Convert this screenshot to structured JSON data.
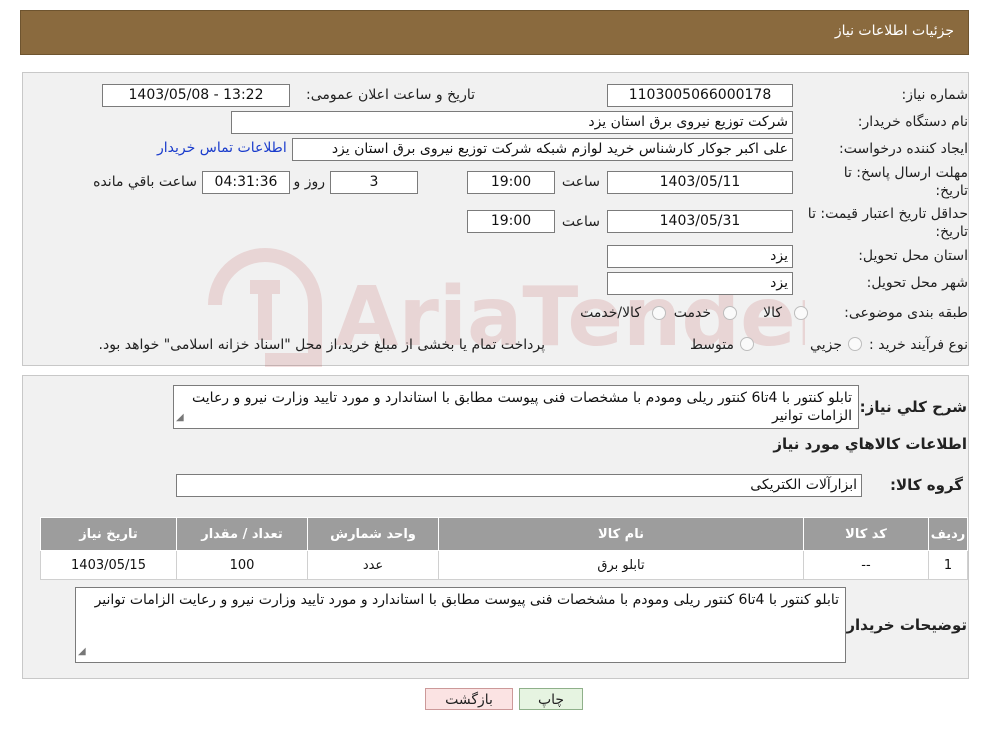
{
  "header": {
    "title": "جزئیات اطلاعات نیاز"
  },
  "info": {
    "need_number_label": "شماره نیاز:",
    "need_number": "1103005066000178",
    "announce_label": "تاریخ و ساعت اعلان عمومی:",
    "announce_value": "1403/05/08 - 13:22",
    "buyer_org_label": "نام دستگاه خریدار:",
    "buyer_org": "شرکت توزیع نیروی برق استان یزد",
    "creator_label": "ایجاد کننده درخواست:",
    "creator": "علی اکبر  جوکار  کارشناس خرید لوازم شبکه  شرکت توزیع نیروی برق استان یزد",
    "contact_link": "اطلاعات تماس خریدار",
    "deadline_label_1": "مهلت ارسال پاسخ: تا",
    "deadline_label_2": "تاریخ:",
    "deadline_date": "1403/05/11",
    "time_label": "ساعت",
    "deadline_time": "19:00",
    "days_value": "3",
    "days_label": "روز و",
    "remaining_time": "04:31:36",
    "remaining_label": "ساعت باقي مانده",
    "validity_label_1": "حداقل تاریخ اعتبار قیمت: تا",
    "validity_label_2": "تاریخ:",
    "validity_date": "1403/05/31",
    "validity_time": "19:00",
    "province_label": "استان محل تحویل:",
    "province": "یزد",
    "city_label": "شهر محل تحویل:",
    "city": "یزد",
    "category_label": "طبقه بندی موضوعی:",
    "category_options": [
      "کالا",
      "خدمت",
      "کالا/خدمت"
    ],
    "process_label": "نوع فرآیند خرید :",
    "process_options": [
      "جزيي",
      "متوسط"
    ],
    "process_note": "پرداخت تمام یا بخشی از مبلغ خرید،از محل \"اسناد خزانه اسلامی\" خواهد بود."
  },
  "details": {
    "summary_label": "شرح کلي نياز:",
    "summary_text": "تابلو  کنتور با 4تا6 کنتور ریلی ومودم  با مشخصات فنی پیوست مطابق با استاندارد و مورد تایید وزارت نیرو  و رعایت الزامات توانیر",
    "goods_info_title": "اطلاعات کالاهاي مورد نياز",
    "group_label": "گروه کالا:",
    "group_value": "ابزارآلات الکتریکی",
    "table": {
      "headers": [
        "رديف",
        "کد کالا",
        "نام کالا",
        "واحد شمارش",
        "تعداد / مقدار",
        "تاريخ نياز"
      ],
      "rows": [
        [
          "1",
          "--",
          "تابلو برق",
          "عدد",
          "100",
          "1403/05/15"
        ]
      ]
    },
    "buyer_notes_label": "توضیحات خریدار:",
    "buyer_notes": "تابلو  کنتور با 4تا6 کنتور ریلی ومودم  با مشخصات فنی پیوست مطابق با استاندارد و مورد تایید وزارت نیرو  و رعایت الزامات توانیر"
  },
  "buttons": {
    "print": "چاپ",
    "back": "بازگشت"
  },
  "watermark": "AriaTender.neT",
  "colors": {
    "header_bg": "#8a6a3e",
    "table_header_bg": "#9d9d9d",
    "link": "#1a3ccc",
    "back_btn_bg": "#fbe3e3",
    "print_btn_bg": "#e6f4e1"
  }
}
